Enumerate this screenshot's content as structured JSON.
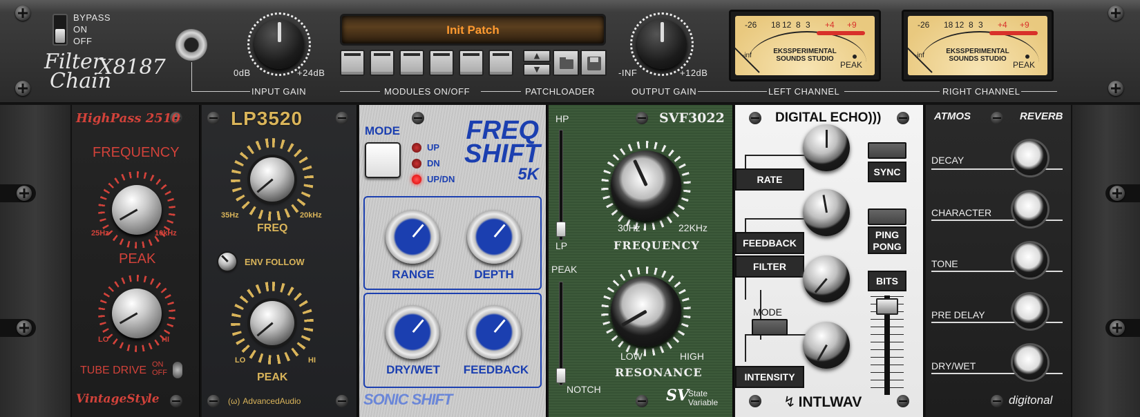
{
  "topbar": {
    "bypass": {
      "title": "BYPASS",
      "on": "ON",
      "off": "OFF"
    },
    "logo": {
      "line1": "Filter",
      "line2": "Chain",
      "model": "X8187"
    },
    "input_gain": {
      "label": "INPUT GAIN",
      "min": "0dB",
      "max": "+24dB"
    },
    "patch_display": "Init Patch",
    "modules_label": "MODULES ON/OFF",
    "patchloader_label": "PATCHLOADER",
    "output_gain": {
      "label": "OUTPUT GAIN",
      "min": "-INF",
      "max": "+12dB"
    },
    "left_channel_label": "LEFT CHANNEL",
    "right_channel_label": "RIGHT CHANNEL",
    "vu": {
      "scale": [
        "-26",
        "18",
        "12",
        "8",
        "3",
        "+4",
        "+9"
      ],
      "inf": "-inf",
      "brand": "EKSSPERIMENTAL SOUNDS STUDIO",
      "peak": "PEAK"
    }
  },
  "highpass": {
    "title": "HighPass 2510",
    "frequency_label": "FREQUENCY",
    "freq_min": "25Hz",
    "freq_max": "10kHz",
    "peak_label": "PEAK",
    "peak_min": "LO",
    "peak_max": "HI",
    "tube_drive": "TUBE DRIVE",
    "on": "ON",
    "off": "OFF",
    "brand": "VintageStyle"
  },
  "lp3520": {
    "title": "LP3520",
    "freq_min": "35Hz",
    "freq_max": "20kHz",
    "freq_label": "FREQ",
    "env_follow": "ENV FOLLOW",
    "peak_min": "LO",
    "peak_max": "HI",
    "peak_label": "PEAK",
    "brand": "AdvancedAudio"
  },
  "freqshift": {
    "mode_label": "MODE",
    "modes": [
      "UP",
      "DN",
      "UP/DN"
    ],
    "title_line1": "FREQ",
    "title_line2": "SHIFT",
    "title_line3": "5K",
    "range": "RANGE",
    "depth": "DEPTH",
    "drywet": "DRY/WET",
    "feedback": "FEEDBACK",
    "brand": "SONIC SHIFT"
  },
  "svf": {
    "title": "SVF3022",
    "hp": "HP",
    "lp": "LP",
    "freq_min": "30Hz",
    "freq_max": "22KHz",
    "frequency": "FREQUENCY",
    "peak": "PEAK",
    "notch": "NOTCH",
    "res_min": "LOW",
    "res_max": "HIGH",
    "resonance": "RESONANCE",
    "logo": "SV",
    "brand_line1": "State",
    "brand_line2": "Variable"
  },
  "echo": {
    "title": "DIGITAL ECHO)))",
    "rate": "RATE",
    "sync": "SYNC",
    "feedback": "FEEDBACK",
    "ping": "PING",
    "pong": "PONG",
    "filter": "FILTER",
    "bits": "BITS",
    "mode": "MODE",
    "intensity": "INTENSITY",
    "brand": "INTLWAV"
  },
  "reverb": {
    "title_left": "ATMOS",
    "title_right": "REVERB",
    "decay": "DECAY",
    "character": "CHARACTER",
    "tone": "TONE",
    "predelay": "PRE DELAY",
    "drywet": "DRY/WET",
    "brand": "digitonal"
  },
  "colors": {
    "display_text": "#ff9a30",
    "vu_red": "#d8302a",
    "svf_green": "#3d5a3a",
    "fs_blue": "#1b3fb0",
    "hp_red": "#d2423a",
    "lp_gold": "#d9b45a"
  }
}
